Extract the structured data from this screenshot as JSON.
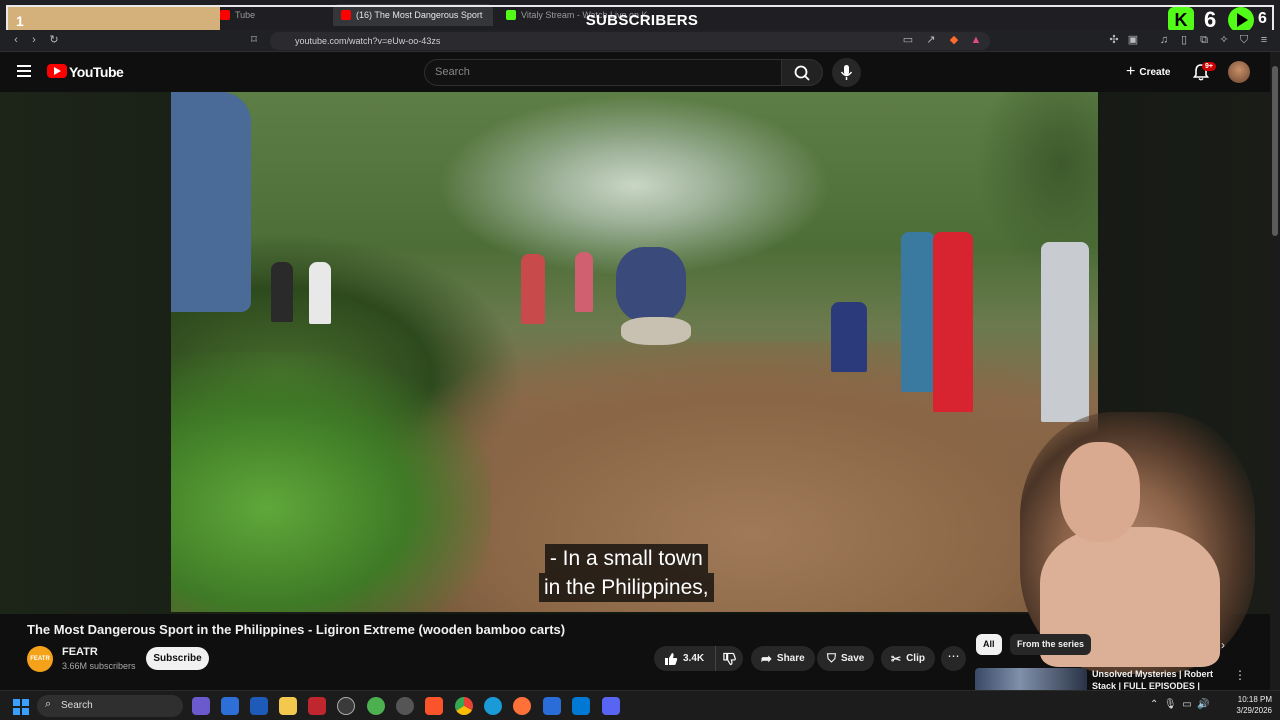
{
  "overlay": {
    "subscriber_count": "1",
    "label": "SUBSCRIBERS",
    "kick_count": "6",
    "play_count": "6",
    "kick_glyph": "K"
  },
  "browser": {
    "tabs": [
      {
        "label": "Tube",
        "favicon_color": "#ff0000",
        "active": false
      },
      {
        "label": "(16) The Most Dangerous Sport",
        "favicon_color": "#ff0000",
        "active": true
      },
      {
        "label": "Vitaly Stream - Watch Live on Kick",
        "favicon_color": "#53fc18",
        "active": false
      }
    ],
    "tab_close": "×",
    "url": "youtube.com/watch?v=eUw-oo-43zs"
  },
  "youtube": {
    "wordmark": "YouTube",
    "search_placeholder": "Search",
    "create_label": "Create",
    "notification_badge": "9+"
  },
  "video": {
    "caption_line1": "- In a small town",
    "caption_line2": "in the Philippines,",
    "title": "The Most Dangerous Sport in the Philippines - Ligiron Extreme (wooden bamboo carts)"
  },
  "channel": {
    "name": "FEATR",
    "avatar_text": "FEATR",
    "subscribers": "3.66M subscribers",
    "subscribe_label": "Subscribe"
  },
  "actions": {
    "likes": "3.4K",
    "share_label": "Share",
    "save_label": "Save",
    "clip_label": "Clip",
    "more": "⋯"
  },
  "sidebar": {
    "chip_all": "All",
    "chip_series": "From the series",
    "rec_title": "Unsolved Mysteries | Robert Stack | FULL EPISODES |"
  },
  "taskbar": {
    "search_label": "Search",
    "time": "10:18 PM",
    "date": "3/29/2026"
  },
  "colors": {
    "brand_red": "#ff0000",
    "kick_green": "#53fc18",
    "overlay_bar": "#d4b07a"
  }
}
